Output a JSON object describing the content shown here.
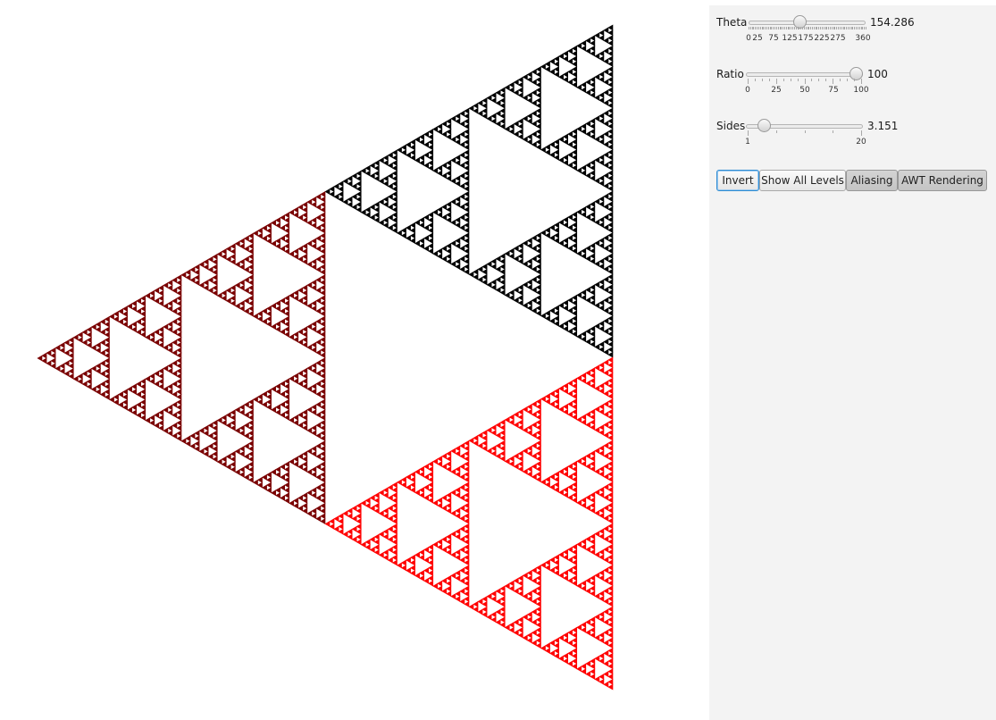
{
  "fractal": {
    "depth": 7,
    "colors": {
      "top_branch": "#000000",
      "left_branch": "#7a0000",
      "bottom_branch": "#ff0000"
    }
  },
  "controls": {
    "theta": {
      "label": "Theta",
      "value_text": "154.286",
      "min": 0,
      "max": 360,
      "value": 154.286,
      "tick_labels": [
        "0",
        "25",
        "75",
        "125",
        "175",
        "225",
        "275",
        "360"
      ]
    },
    "ratio": {
      "label": "Ratio",
      "value_text": "100",
      "min": 0,
      "max": 100,
      "value": 100,
      "tick_labels": [
        "0",
        "25",
        "50",
        "75",
        "100"
      ]
    },
    "sides": {
      "label": "Sides",
      "value_text": "3.151",
      "min": 1,
      "max": 20,
      "value": 3.151,
      "tick_labels": [
        "1",
        "20"
      ]
    }
  },
  "buttons": {
    "invert": "Invert",
    "show_all_levels": "Show All Levels",
    "aliasing": "Aliasing",
    "awt_rendering": "AWT Rendering"
  }
}
